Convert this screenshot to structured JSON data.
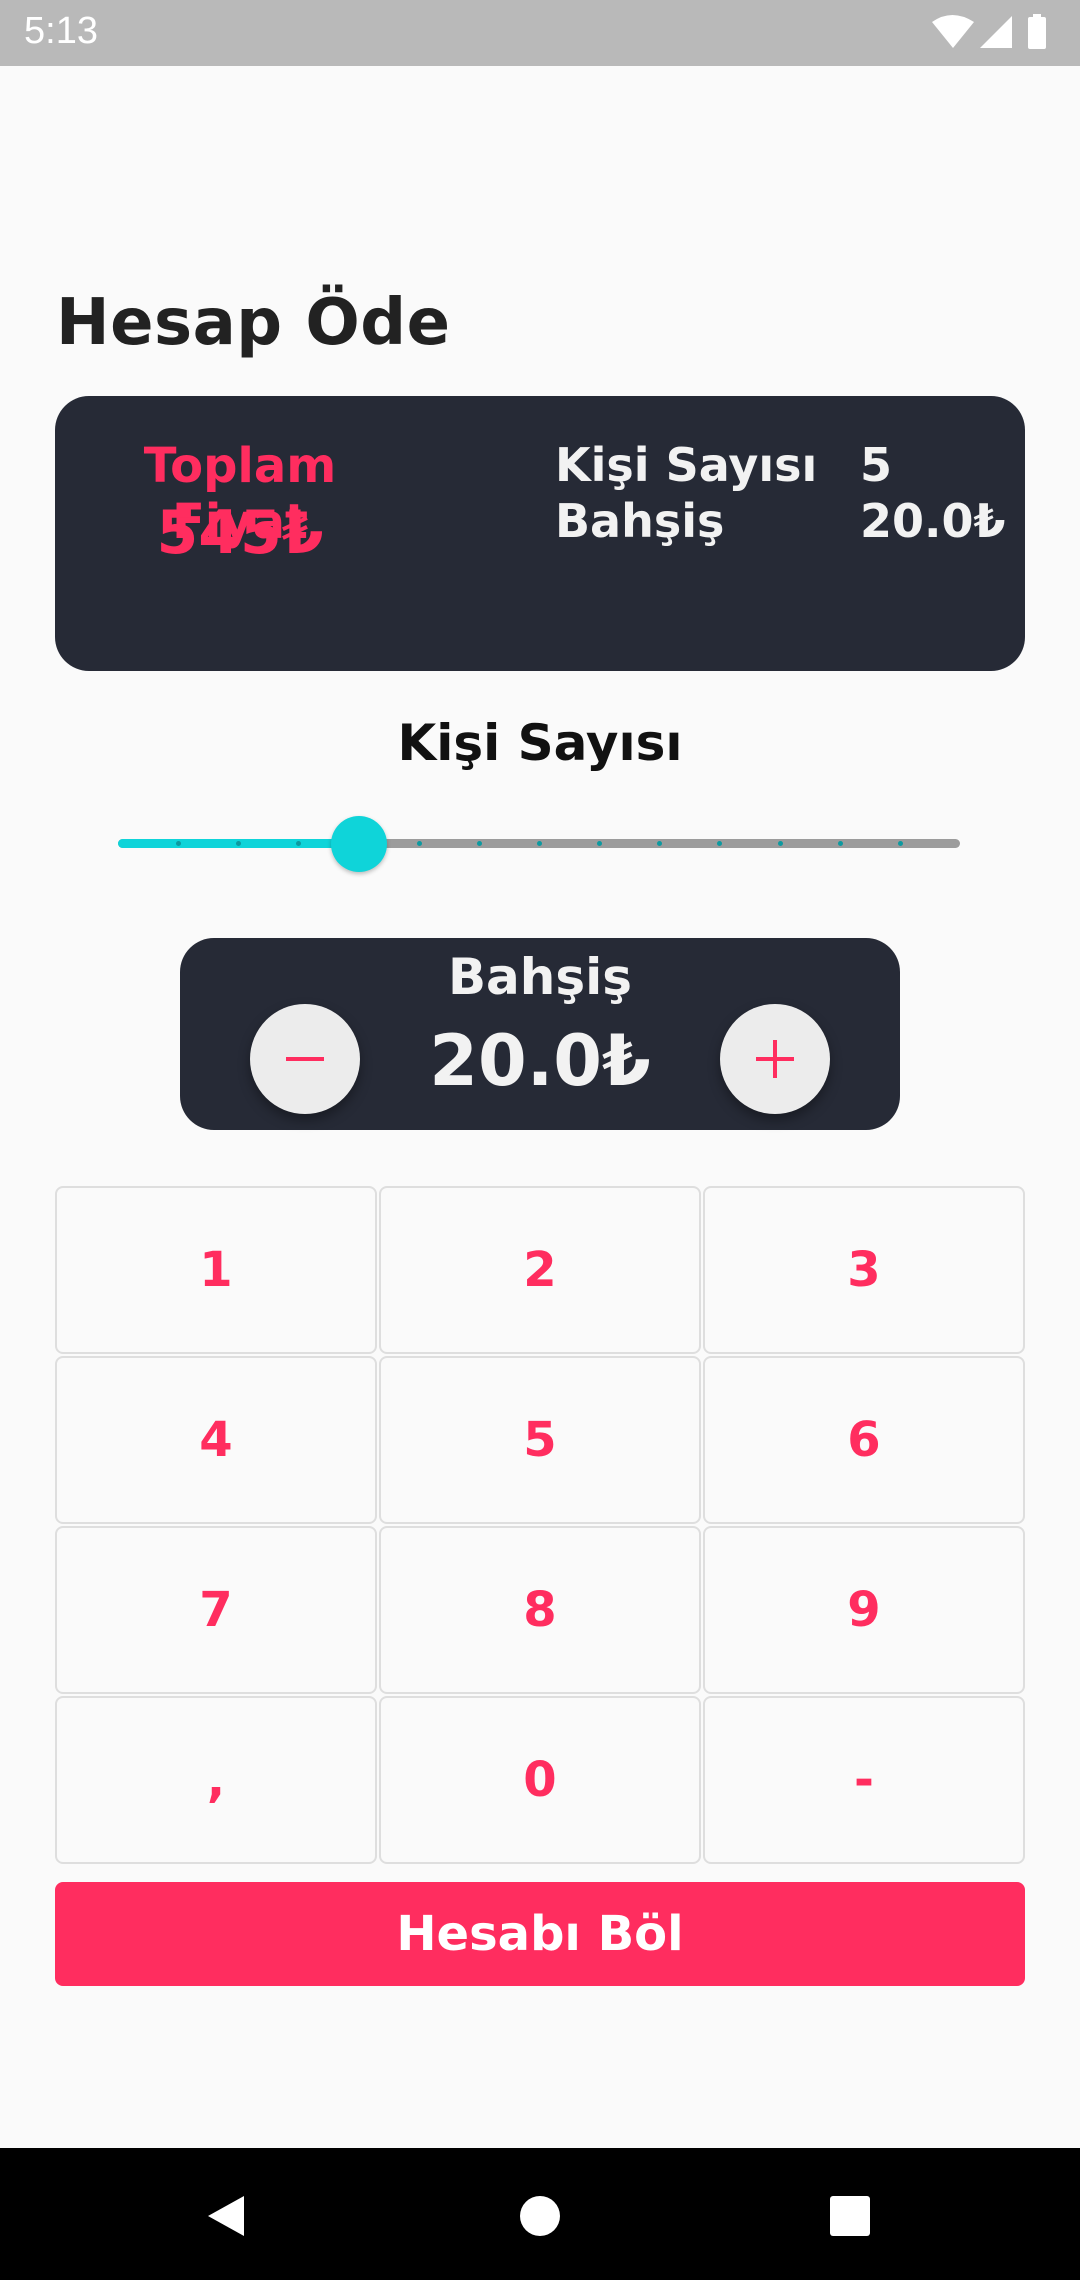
{
  "status_bar": {
    "time": "5:13",
    "icons": [
      "wifi-icon",
      "signal-icon",
      "battery-icon"
    ]
  },
  "title": "Hesap Öde",
  "summary": {
    "total_label": "Toplam Fiyat",
    "total_value": "545₺",
    "people_label": "Kişi Sayısı",
    "people_value": "5",
    "tip_label": "Bahşiş",
    "tip_value": "20.0₺"
  },
  "people_slider": {
    "label": "Kişi Sayısı",
    "value": 5,
    "min": 1,
    "max": 15
  },
  "tip": {
    "title": "Bahşiş",
    "amount": "20.0₺",
    "decrease_icon": "minus-icon",
    "increase_icon": "plus-icon"
  },
  "keypad": {
    "keys": [
      "1",
      "2",
      "3",
      "4",
      "5",
      "6",
      "7",
      "8",
      "9",
      ",",
      "0",
      "-"
    ]
  },
  "split_button": "Hesabı Böl",
  "nav_bar": {
    "icons": [
      "back-icon",
      "home-icon",
      "recents-icon"
    ]
  },
  "colors": {
    "accent": "#ff2d5f",
    "card": "#262a36",
    "slider": "#0fd4d9",
    "background": "#fafafa"
  }
}
